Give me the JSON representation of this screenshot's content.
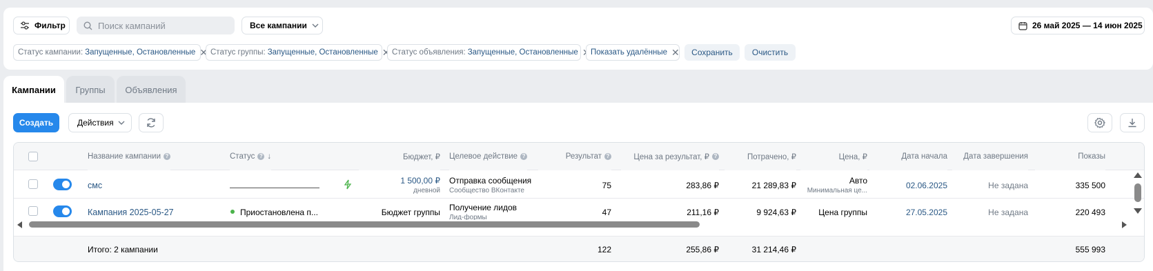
{
  "filter_bar": {
    "filter_label": "Фильтр",
    "search_placeholder": "Поиск кампаний",
    "campaigns_select": "Все кампании",
    "date_range": "26 май 2025 — 14 июн 2025"
  },
  "chips": [
    {
      "key": "Статус кампании:",
      "value": "Запущенные, Остановленные"
    },
    {
      "key": "Статус группы:",
      "value": "Запущенные, Остановленные"
    },
    {
      "key": "Статус объявления:",
      "value": "Запущенные, Остановленные"
    },
    {
      "key": "",
      "value": "Показать удалённые"
    }
  ],
  "chip_actions": {
    "save": "Сохранить",
    "clear": "Очистить"
  },
  "tabs": [
    "Кампании",
    "Группы",
    "Объявления"
  ],
  "toolbar": {
    "create": "Создать",
    "actions": "Действия"
  },
  "columns": {
    "name": "Название кампании",
    "status": "Статус",
    "sort_arrow": "↓",
    "budget": "Бюджет, ₽",
    "target": "Целевое действие",
    "result": "Результат",
    "cpr": "Цена за результат, ₽",
    "spent": "Потрачено, ₽",
    "price": "Цена, ₽",
    "start": "Дата начала",
    "end": "Дата завершения",
    "shows": "Показы"
  },
  "rows": [
    {
      "name": "смс",
      "status": "",
      "budget": "1 500,00 ₽",
      "budget_sub": "дневной",
      "target": "Отправка сообщения",
      "target_sub": "Сообщество ВКонтакте",
      "result": "75",
      "cpr": "283,86 ₽",
      "spent": "21 289,83 ₽",
      "price": "Авто",
      "price_sub": "Минимальная це...",
      "start": "02.06.2025",
      "end": "Не задана",
      "shows": "335 500"
    },
    {
      "name": "Кампания 2025-05-27",
      "status": "Приостановлена п...",
      "budget": "Бюджет группы",
      "target": "Получение лидов",
      "target_sub": "Лид-формы",
      "result": "47",
      "cpr": "211,16 ₽",
      "spent": "9 924,63 ₽",
      "price": "Цена группы",
      "start": "27.05.2025",
      "end": "Не задана",
      "shows": "220 493"
    }
  ],
  "totals": {
    "label": "Итого: 2 кампании",
    "result": "122",
    "cpr": "255,86 ₽",
    "spent": "31 214,46 ₽",
    "shows": "555 993"
  },
  "colors": {
    "accent": "#2688eb",
    "link": "#2a5885",
    "status_dot": "#4bb34b"
  }
}
